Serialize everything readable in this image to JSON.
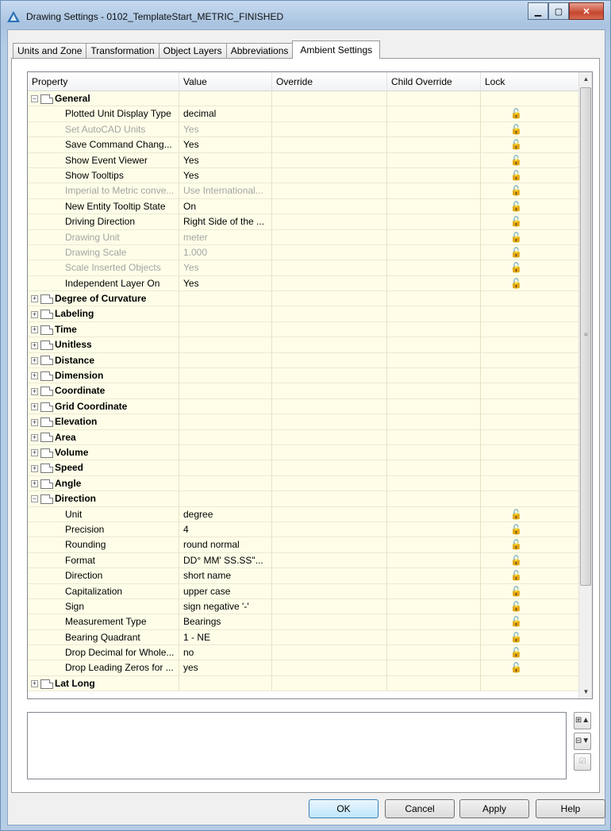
{
  "window": {
    "title": "Drawing Settings - 0102_TemplateStart_METRIC_FINISHED"
  },
  "tabs": [
    "Units and Zone",
    "Transformation",
    "Object Layers",
    "Abbreviations",
    "Ambient Settings"
  ],
  "active_tab": "Ambient Settings",
  "columns": [
    "Property",
    "Value",
    "Override",
    "Child Override",
    "Lock"
  ],
  "rows": [
    {
      "type": "group",
      "label": "General",
      "expanded": true
    },
    {
      "type": "prop",
      "label": "Plotted Unit Display Type",
      "value": "decimal",
      "lock": true
    },
    {
      "type": "prop",
      "label": "Set AutoCAD Units",
      "value": "Yes",
      "lock": true,
      "disabled": true
    },
    {
      "type": "prop",
      "label": "Save Command Chang...",
      "value": "Yes",
      "lock": true
    },
    {
      "type": "prop",
      "label": "Show Event Viewer",
      "value": "Yes",
      "lock": true
    },
    {
      "type": "prop",
      "label": "Show Tooltips",
      "value": "Yes",
      "lock": true
    },
    {
      "type": "prop",
      "label": "Imperial to Metric conve...",
      "value": "Use International...",
      "lock": true,
      "disabled": true
    },
    {
      "type": "prop",
      "label": "New Entity Tooltip State",
      "value": "On",
      "lock": true
    },
    {
      "type": "prop",
      "label": "Driving Direction",
      "value": "Right Side of the ...",
      "lock": true
    },
    {
      "type": "prop",
      "label": "Drawing Unit",
      "value": "meter",
      "lock": true,
      "disabled": true
    },
    {
      "type": "prop",
      "label": "Drawing Scale",
      "value": "1.000",
      "lock": true,
      "disabled": true
    },
    {
      "type": "prop",
      "label": "Scale Inserted Objects",
      "value": "Yes",
      "lock": true,
      "disabled": true
    },
    {
      "type": "prop",
      "label": "Independent Layer On",
      "value": "Yes",
      "lock": true
    },
    {
      "type": "group",
      "label": "Degree of Curvature",
      "expanded": false
    },
    {
      "type": "group",
      "label": "Labeling",
      "expanded": false
    },
    {
      "type": "group",
      "label": "Time",
      "expanded": false
    },
    {
      "type": "group",
      "label": "Unitless",
      "expanded": false
    },
    {
      "type": "group",
      "label": "Distance",
      "expanded": false
    },
    {
      "type": "group",
      "label": "Dimension",
      "expanded": false
    },
    {
      "type": "group",
      "label": "Coordinate",
      "expanded": false
    },
    {
      "type": "group",
      "label": "Grid Coordinate",
      "expanded": false
    },
    {
      "type": "group",
      "label": "Elevation",
      "expanded": false
    },
    {
      "type": "group",
      "label": "Area",
      "expanded": false
    },
    {
      "type": "group",
      "label": "Volume",
      "expanded": false
    },
    {
      "type": "group",
      "label": "Speed",
      "expanded": false
    },
    {
      "type": "group",
      "label": "Angle",
      "expanded": false
    },
    {
      "type": "group",
      "label": "Direction",
      "expanded": true
    },
    {
      "type": "prop",
      "label": "Unit",
      "value": "degree",
      "lock": true
    },
    {
      "type": "prop",
      "label": "Precision",
      "value": "4",
      "lock": true
    },
    {
      "type": "prop",
      "label": "Rounding",
      "value": "round normal",
      "lock": true
    },
    {
      "type": "prop",
      "label": "Format",
      "value": "DD° MM' SS.SS\"...",
      "lock": true
    },
    {
      "type": "prop",
      "label": "Direction",
      "value": "short name",
      "lock": true
    },
    {
      "type": "prop",
      "label": "Capitalization",
      "value": "upper case",
      "lock": true
    },
    {
      "type": "prop",
      "label": "Sign",
      "value": "sign negative '-'",
      "lock": true
    },
    {
      "type": "prop",
      "label": "Measurement Type",
      "value": "Bearings",
      "lock": true
    },
    {
      "type": "prop",
      "label": "Bearing Quadrant",
      "value": "1 - NE",
      "lock": true
    },
    {
      "type": "prop",
      "label": "Drop Decimal for Whole...",
      "value": "no",
      "lock": true
    },
    {
      "type": "prop",
      "label": "Drop Leading Zeros for ...",
      "value": "yes",
      "lock": true
    },
    {
      "type": "group",
      "label": "Lat Long",
      "expanded": false
    }
  ],
  "lock_glyph": "🔓",
  "buttons": {
    "ok": "OK",
    "cancel": "Cancel",
    "apply": "Apply",
    "help": "Help"
  },
  "colors": {
    "grid_bg": "#fefee8",
    "disabled_text": "#a4a4a4",
    "title_close": "#c6462f"
  }
}
